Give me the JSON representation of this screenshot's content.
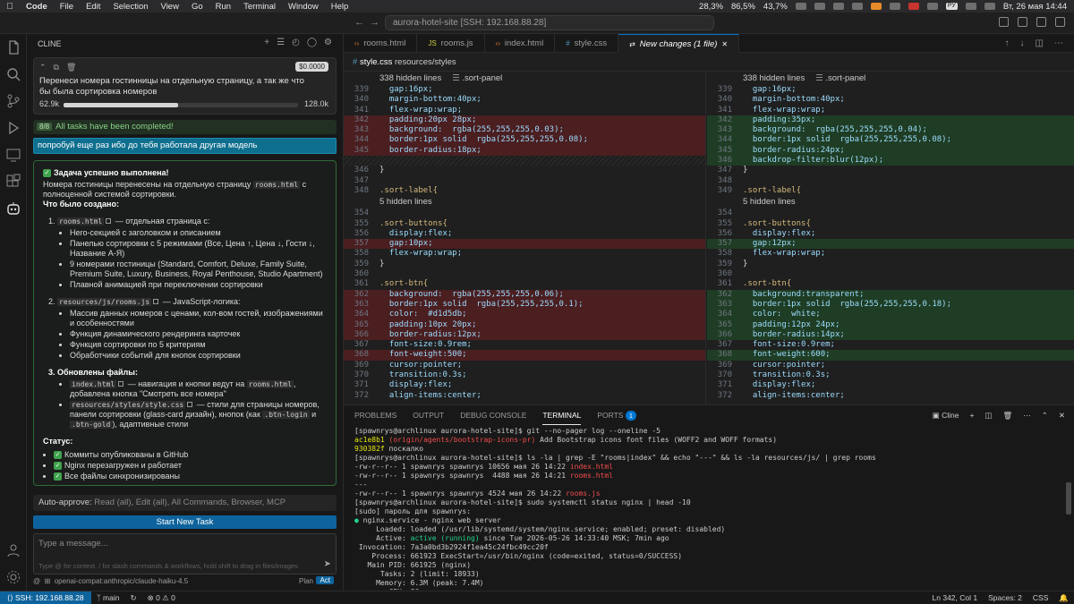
{
  "menubar": {
    "app": "Code",
    "items": [
      "File",
      "Edit",
      "Selection",
      "View",
      "Go",
      "Run",
      "Terminal",
      "Window",
      "Help"
    ],
    "cpu": "28,3%",
    "mem": "86,5%",
    "battery": "43,7%",
    "lang": "РУ",
    "clock": "Вт, 26 мая  14:44"
  },
  "titlebar": {
    "search": "aurora-hotel-site [SSH: 192.168.88.28]"
  },
  "sidebar": {
    "title": "CLINE",
    "task": {
      "cost": "$0.0000",
      "text": "Перенеси номера гостинницы на отдельную страницу, а так же что бы была сортировка номеров",
      "tokens_in": "62.9k",
      "tokens_max": "128.0k",
      "progress": 0.49
    },
    "done_count": "8/8",
    "done_text": "All tasks have been completed!",
    "user_msg": "попробуй еще раз ибо до тебя работала другая модель",
    "completion": {
      "heading": "Задача успешно выполнена!",
      "intro_a": "Номера гостиницы перенесены на отдельную страницу",
      "intro_code": "rooms.html",
      "intro_b": "с полноценной системой сортировки.",
      "created": "Что было создано:",
      "item1_num": "1.",
      "item1_code": "rooms.html",
      "item1_tail": "— отдельная страница с:",
      "item1_bullets": [
        "Hero-секцией с заголовком и описанием",
        "Панелью сортировки с 5 режимами (Все, Цена ↑, Цена ↓, Гости ↓, Название А-Я)",
        "9 номерами гостиницы (Standard, Comfort, Deluxe, Family Suite, Premium Suite, Luxury, Business, Royal Penthouse, Studio Apartment)",
        "Плавной анимацией при переключении сортировки"
      ],
      "item2_num": "2.",
      "item2_code": "resources/js/rooms.js",
      "item2_tail": "— JavaScript-логика:",
      "item2_bullets": [
        "Массив данных номеров с ценами, кол-вом гостей, изображениями и особенностями",
        "Функция динамического рендеринга карточек",
        "Функция сортировки по 5 критериям",
        "Обработчики событий для кнопок сортировки"
      ],
      "item3_title": "3. Обновлены файлы:",
      "item3_a_code": "index.html",
      "item3_a_tail": "— навигация и кнопки ведут на",
      "item3_a_code2": "rooms.html",
      "item3_a_tail2": ", добавлена кнопка \"Смотреть все номера\"",
      "item3_b_code": "resources/styles/style.css",
      "item3_b_tail": "— стили для страницы номеров, панели сортировки (glass-card дизайн), кнопок (как",
      "item3_b_code2": ".btn-login",
      "item3_b_mid": "и",
      "item3_b_code3": ".btn-gold",
      "item3_b_end": "), адаптивные стили",
      "status": "Статус:",
      "status_items": [
        "Коммиты опубликованы в GitHub",
        "Nginx перезагружен и работает",
        "Все файлы синхронизированы"
      ]
    },
    "autoapprove_label": "Auto-approve:",
    "autoapprove_value": "Read (all), Edit (all), All Commands, Browser, MCP",
    "start_button": "Start New Task",
    "msg_placeholder": "Type a message...",
    "msg_hint": "Type @ for context, / for slash commands & workflows, hold shift to drag in files/images",
    "model": "openai-compat:anthropic/claude-haiku-4.5",
    "plan": "Plan",
    "act": "Act"
  },
  "tabs": [
    {
      "icon": "‹›",
      "label": "rooms.html",
      "color": "#e37933"
    },
    {
      "icon": "JS",
      "label": "rooms.js",
      "color": "#cbcb41"
    },
    {
      "icon": "‹›",
      "label": "index.html",
      "color": "#e37933"
    },
    {
      "icon": "#",
      "label": "style.css",
      "color": "#519aba"
    },
    {
      "icon": "⇄",
      "label": "New changes (1 file)",
      "color": "#cccccc"
    }
  ],
  "breadcrumb": {
    "file": "style.css",
    "path": "resources/styles"
  },
  "diff": {
    "hidden1": "338 hidden lines",
    "ctx1": ".sort-panel",
    "hidden2": "5 hidden lines",
    "left": [
      {
        "n": "339",
        "t": "  gap:16px;",
        "k": ""
      },
      {
        "n": "340",
        "t": "  margin-bottom:40px;",
        "k": ""
      },
      {
        "n": "341",
        "t": "  flex-wrap:wrap;",
        "k": ""
      },
      {
        "n": "342",
        "t": "  padding:20px 28px;",
        "k": "del"
      },
      {
        "n": "343",
        "t": "  background:  rgba(255,255,255,0.03);",
        "k": "del"
      },
      {
        "n": "344",
        "t": "  border:1px solid  rgba(255,255,255,0.08);",
        "k": "del"
      },
      {
        "n": "345",
        "t": "  border-radius:18px;",
        "k": "del"
      },
      {
        "n": "",
        "t": "",
        "k": "blank"
      },
      {
        "n": "346",
        "t": "}",
        "k": ""
      },
      {
        "n": "347",
        "t": "",
        "k": ""
      },
      {
        "n": "348",
        "t": ".sort-label{",
        "k": ""
      }
    ],
    "right": [
      {
        "n": "339",
        "t": "  gap:16px;",
        "k": ""
      },
      {
        "n": "340",
        "t": "  margin-bottom:40px;",
        "k": ""
      },
      {
        "n": "341",
        "t": "  flex-wrap:wrap;",
        "k": ""
      },
      {
        "n": "342",
        "t": "  padding:35px;",
        "k": "add"
      },
      {
        "n": "343",
        "t": "  background:  rgba(255,255,255,0.04);",
        "k": "add"
      },
      {
        "n": "344",
        "t": "  border:1px solid  rgba(255,255,255,0.08);",
        "k": "add"
      },
      {
        "n": "345",
        "t": "  border-radius:24px;",
        "k": "add"
      },
      {
        "n": "346",
        "t": "  backdrop-filter:blur(12px);",
        "k": "add"
      },
      {
        "n": "347",
        "t": "}",
        "k": ""
      },
      {
        "n": "348",
        "t": "",
        "k": ""
      },
      {
        "n": "349",
        "t": ".sort-label{",
        "k": ""
      }
    ],
    "left2": [
      {
        "n": "354",
        "t": "",
        "k": ""
      },
      {
        "n": "355",
        "t": ".sort-buttons{",
        "k": ""
      },
      {
        "n": "356",
        "t": "  display:flex;",
        "k": ""
      },
      {
        "n": "357",
        "t": "  gap:10px;",
        "k": "del"
      },
      {
        "n": "358",
        "t": "  flex-wrap:wrap;",
        "k": ""
      },
      {
        "n": "359",
        "t": "}",
        "k": ""
      },
      {
        "n": "360",
        "t": "",
        "k": ""
      },
      {
        "n": "361",
        "t": ".sort-btn{",
        "k": ""
      },
      {
        "n": "362",
        "t": "  background:  rgba(255,255,255,0.06);",
        "k": "del"
      },
      {
        "n": "363",
        "t": "  border:1px solid  rgba(255,255,255,0.1);",
        "k": "del"
      },
      {
        "n": "364",
        "t": "  color:  #d1d5db;",
        "k": "del"
      },
      {
        "n": "365",
        "t": "  padding:10px 20px;",
        "k": "del"
      },
      {
        "n": "366",
        "t": "  border-radius:12px;",
        "k": "del"
      },
      {
        "n": "367",
        "t": "  font-size:0.9rem;",
        "k": ""
      },
      {
        "n": "368",
        "t": "  font-weight:500;",
        "k": "del"
      },
      {
        "n": "369",
        "t": "  cursor:pointer;",
        "k": ""
      },
      {
        "n": "370",
        "t": "  transition:0.3s;",
        "k": ""
      },
      {
        "n": "371",
        "t": "  display:flex;",
        "k": ""
      },
      {
        "n": "372",
        "t": "  align-items:center;",
        "k": ""
      }
    ],
    "right2": [
      {
        "n": "354",
        "t": "",
        "k": ""
      },
      {
        "n": "355",
        "t": ".sort-buttons{",
        "k": ""
      },
      {
        "n": "356",
        "t": "  display:flex;",
        "k": ""
      },
      {
        "n": "357",
        "t": "  gap:12px;",
        "k": "add"
      },
      {
        "n": "358",
        "t": "  flex-wrap:wrap;",
        "k": ""
      },
      {
        "n": "359",
        "t": "}",
        "k": ""
      },
      {
        "n": "360",
        "t": "",
        "k": ""
      },
      {
        "n": "361",
        "t": ".sort-btn{",
        "k": ""
      },
      {
        "n": "362",
        "t": "  background:transparent;",
        "k": "add"
      },
      {
        "n": "363",
        "t": "  border:1px solid  rgba(255,255,255,0.18);",
        "k": "add"
      },
      {
        "n": "364",
        "t": "  color:  white;",
        "k": "add"
      },
      {
        "n": "365",
        "t": "  padding:12px 24px;",
        "k": "add"
      },
      {
        "n": "366",
        "t": "  border-radius:14px;",
        "k": "add"
      },
      {
        "n": "367",
        "t": "  font-size:0.9rem;",
        "k": ""
      },
      {
        "n": "368",
        "t": "  font-weight:600;",
        "k": "add"
      },
      {
        "n": "369",
        "t": "  cursor:pointer;",
        "k": ""
      },
      {
        "n": "370",
        "t": "  transition:0.3s;",
        "k": ""
      },
      {
        "n": "371",
        "t": "  display:flex;",
        "k": ""
      },
      {
        "n": "372",
        "t": "  align-items:center;",
        "k": ""
      }
    ]
  },
  "panel": {
    "tabs": [
      "PROBLEMS",
      "OUTPUT",
      "DEBUG CONSOLE",
      "TERMINAL",
      "PORTS"
    ],
    "ports_badge": "1",
    "active": "TERMINAL",
    "right_label": "Cline"
  },
  "terminal": {
    "prompt": "[spawnrys@archlinux aurora-hotel-site]$",
    "cmd1": " git --no-pager log --oneline -5",
    "log1_hash": "ac1e8b1",
    "log1_ref": "(origin/agents/bootstrap-icons-pr)",
    "log1_msg": " Add Bootstrap icons font files (WOFF2 and WOFF formats)",
    "log2_hash": "930382f",
    "log2_msg": " поскалко",
    "cmd2": " ls -la | grep -E \"rooms|index\" && echo \"---\" && ls -la resources/js/ | grep rooms",
    "ls1": "-rw-r--r-- 1 spawnrys spawnrys 10656 мая 26 14:22 ",
    "ls1_f": "index.html",
    "ls2": "-rw-r--r-- 1 spawnrys spawnrys  4488 мая 26 14:21 ",
    "ls2_f": "rooms.html",
    "sep": "---",
    "ls3": "-rw-r--r-- 1 spawnrys spawnrys 4524 мая 26 14:22 ",
    "ls3_f": "rooms.js",
    "cmd3": " sudo systemctl status nginx | head -10",
    "sudo1": "[sudo] пароль для spawnrys:",
    "nginx": [
      "● nginx.service - nginx web server",
      "     Loaded: loaded (/usr/lib/systemd/system/nginx.service; enabled; preset: disabled)",
      "     Active: active (running) since Tue 2026-05-26 14:33:40 MSK; 7min ago",
      " Invocation: 7a3a0bd3b2924f1ea45c24fbc49cc20f",
      "    Process: 661923 ExecStart=/usr/bin/nginx (code=exited, status=0/SUCCESS)",
      "   Main PID: 661925 (nginx)",
      "      Tasks: 2 (limit: 18933)",
      "     Memory: 6.3M (peak: 7.4M)",
      "        CPU: 86ms",
      "     CGroup: /system.slice/nginx.service"
    ],
    "active_word": "active (running)"
  },
  "statusbar": {
    "remote": "SSH: 192.168.88.28",
    "branch": "main",
    "position": "Ln 342, Col 1",
    "spaces": "Spaces: 2",
    "lang": "CSS"
  }
}
